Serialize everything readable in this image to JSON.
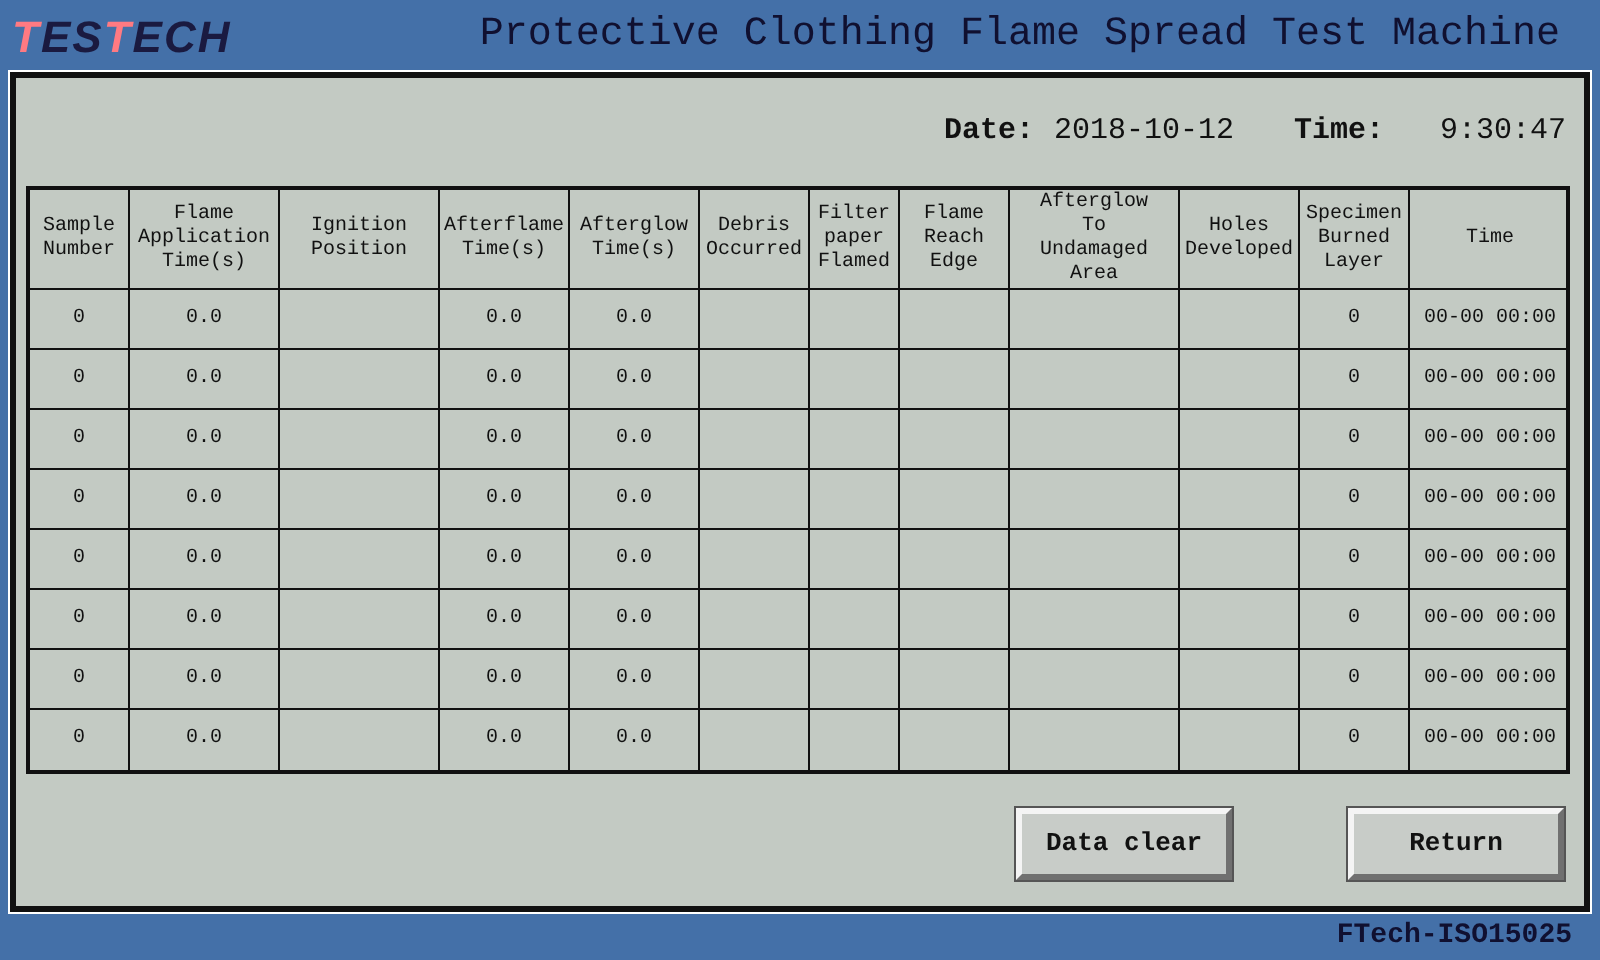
{
  "header": {
    "logo": "TESTECH",
    "title": "Protective Clothing Flame Spread Test Machine"
  },
  "datetime": {
    "date_label": "Date:",
    "date": "2018-10-12",
    "time_label": "Time:",
    "time": "9:30:47"
  },
  "table": {
    "columns": [
      "Sample\nNumber",
      "Flame\nApplication\nTime(s)",
      "Ignition\nPosition",
      "Afterflame\nTime(s)",
      "Afterglow\nTime(s)",
      "Debris\nOccurred",
      "Filter\npaper\nFlamed",
      "Flame\nReach\nEdge",
      "Afterglow\nTo\nUndamaged\nArea",
      "Holes\nDeveloped",
      "Specimen\nBurned\nLayer",
      "Time"
    ],
    "rows": [
      [
        "0",
        "0.0",
        null,
        "0.0",
        "0.0",
        null,
        null,
        null,
        null,
        null,
        "0",
        "00-00 00:00"
      ],
      [
        "0",
        "0.0",
        null,
        "0.0",
        "0.0",
        null,
        null,
        null,
        null,
        null,
        "0",
        "00-00 00:00"
      ],
      [
        "0",
        "0.0",
        null,
        "0.0",
        "0.0",
        null,
        null,
        null,
        null,
        null,
        "0",
        "00-00 00:00"
      ],
      [
        "0",
        "0.0",
        null,
        "0.0",
        "0.0",
        null,
        null,
        null,
        null,
        null,
        "0",
        "00-00 00:00"
      ],
      [
        "0",
        "0.0",
        null,
        "0.0",
        "0.0",
        null,
        null,
        null,
        null,
        null,
        "0",
        "00-00 00:00"
      ],
      [
        "0",
        "0.0",
        null,
        "0.0",
        "0.0",
        null,
        null,
        null,
        null,
        null,
        "0",
        "00-00 00:00"
      ],
      [
        "0",
        "0.0",
        null,
        "0.0",
        "0.0",
        null,
        null,
        null,
        null,
        null,
        "0",
        "00-00 00:00"
      ],
      [
        "0",
        "0.0",
        null,
        "0.0",
        "0.0",
        null,
        null,
        null,
        null,
        null,
        "0",
        "00-00 00:00"
      ]
    ]
  },
  "buttons": [
    "Data clear",
    "Return"
  ],
  "footer": "FTech-ISO15025"
}
